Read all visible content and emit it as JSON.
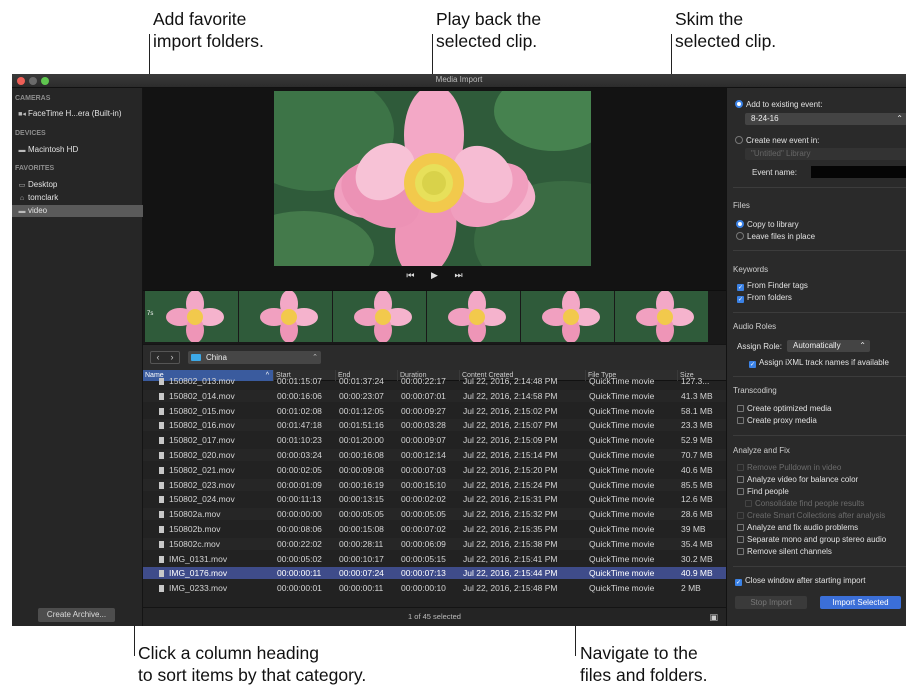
{
  "callouts": {
    "add_favorites": [
      "Add favorite",
      "import folders."
    ],
    "play_back": [
      "Play back the",
      "selected clip."
    ],
    "skim": [
      "Skim the",
      "selected clip."
    ],
    "sort": [
      "Click a column heading",
      "to sort items by that category."
    ],
    "navigate": [
      "Navigate to the",
      "files and folders."
    ]
  },
  "window": {
    "title": "Media Import"
  },
  "sidebar": {
    "cameras_header": "CAMERAS",
    "camera": "FaceTime H...era (Built-in)",
    "devices_header": "DEVICES",
    "device": "Macintosh HD",
    "favorites_header": "FAVORITES",
    "favorites": [
      "Desktop",
      "tomclark",
      "video"
    ],
    "selected_favorite": "video",
    "archive_button": "Create Archive..."
  },
  "transport": {
    "prev": "⏮",
    "play": "▶",
    "next": "⏭"
  },
  "filmstrip": {
    "badge": "7s"
  },
  "nav": {
    "back": "‹",
    "forward": "›",
    "folder": "China"
  },
  "table": {
    "columns": [
      "Name",
      "Start",
      "End",
      "Duration",
      "Content Created",
      "File Type",
      "Size"
    ],
    "sorted_column": "Name",
    "rows": [
      [
        "150802_013.mov",
        "00:01:15:07",
        "00:01:37:24",
        "00:00:22:17",
        "Jul 22, 2016, 2:14:48 PM",
        "QuickTime movie",
        "127.3..."
      ],
      [
        "150802_014.mov",
        "00:00:16:06",
        "00:00:23:07",
        "00:00:07:01",
        "Jul 22, 2016, 2:14:58 PM",
        "QuickTime movie",
        "41.3 MB"
      ],
      [
        "150802_015.mov",
        "00:01:02:08",
        "00:01:12:05",
        "00:00:09:27",
        "Jul 22, 2016, 2:15:02 PM",
        "QuickTime movie",
        "58.1 MB"
      ],
      [
        "150802_016.mov",
        "00:01:47:18",
        "00:01:51:16",
        "00:00:03:28",
        "Jul 22, 2016, 2:15:07 PM",
        "QuickTime movie",
        "23.3 MB"
      ],
      [
        "150802_017.mov",
        "00:01:10:23",
        "00:01:20:00",
        "00:00:09:07",
        "Jul 22, 2016, 2:15:09 PM",
        "QuickTime movie",
        "52.9 MB"
      ],
      [
        "150802_020.mov",
        "00:00:03:24",
        "00:00:16:08",
        "00:00:12:14",
        "Jul 22, 2016, 2:15:14 PM",
        "QuickTime movie",
        "70.7 MB"
      ],
      [
        "150802_021.mov",
        "00:00:02:05",
        "00:00:09:08",
        "00:00:07:03",
        "Jul 22, 2016, 2:15:20 PM",
        "QuickTime movie",
        "40.6 MB"
      ],
      [
        "150802_023.mov",
        "00:00:01:09",
        "00:00:16:19",
        "00:00:15:10",
        "Jul 22, 2016, 2:15:24 PM",
        "QuickTime movie",
        "85.5 MB"
      ],
      [
        "150802_024.mov",
        "00:00:11:13",
        "00:00:13:15",
        "00:00:02:02",
        "Jul 22, 2016, 2:15:31 PM",
        "QuickTime movie",
        "12.6 MB"
      ],
      [
        "150802a.mov",
        "00:00:00:00",
        "00:00:05:05",
        "00:00:05:05",
        "Jul 22, 2016, 2:15:32 PM",
        "QuickTime movie",
        "28.6 MB"
      ],
      [
        "150802b.mov",
        "00:00:08:06",
        "00:00:15:08",
        "00:00:07:02",
        "Jul 22, 2016, 2:15:35 PM",
        "QuickTime movie",
        "39 MB"
      ],
      [
        "150802c.mov",
        "00:00:22:02",
        "00:00:28:11",
        "00:00:06:09",
        "Jul 22, 2016, 2:15:38 PM",
        "QuickTime movie",
        "35.4 MB"
      ],
      [
        "IMG_0131.mov",
        "00:00:05:02",
        "00:00:10:17",
        "00:00:05:15",
        "Jul 22, 2016, 2:15:41 PM",
        "QuickTime movie",
        "30.2 MB"
      ],
      [
        "IMG_0176.mov",
        "00:00:00:11",
        "00:00:07:24",
        "00:00:07:13",
        "Jul 22, 2016, 2:15:44 PM",
        "QuickTime movie",
        "40.9 MB"
      ],
      [
        "IMG_0233.mov",
        "00:00:00:01",
        "00:00:00:11",
        "00:00:00:10",
        "Jul 22, 2016, 2:15:48 PM",
        "QuickTime movie",
        "2 MB"
      ]
    ],
    "selected_row": "IMG_0176.mov",
    "footer": "1 of 45 selected"
  },
  "right_panel": {
    "add_existing": "Add to existing event:",
    "event_value": "8-24-16",
    "create_new": "Create new event in:",
    "library_value": "\"Untitled\" Library",
    "event_name_label": "Event name:",
    "files_header": "Files",
    "copy_to_library": "Copy to library",
    "leave_in_place": "Leave files in place",
    "keywords_header": "Keywords",
    "from_finder_tags": "From Finder tags",
    "from_folders": "From folders",
    "audio_roles_header": "Audio Roles",
    "assign_role_label": "Assign Role:",
    "assign_role_value": "Automatically",
    "assign_ixml": "Assign iXML track names if available",
    "transcoding_header": "Transcoding",
    "create_optimized": "Create optimized media",
    "create_proxy": "Create proxy media",
    "analyze_header": "Analyze and Fix",
    "remove_pulldown": "Remove Pulldown in video",
    "analyze_color": "Analyze video for balance color",
    "find_people": "Find people",
    "consolidate_people": "Consolidate find people results",
    "smart_collections": "Create Smart Collections after analysis",
    "analyze_audio": "Analyze and fix audio problems",
    "separate_mono": "Separate mono and group stereo audio",
    "remove_silent": "Remove silent channels",
    "close_window": "Close window after starting import",
    "stop_import": "Stop Import",
    "import_selected": "Import Selected"
  },
  "colors": {
    "accent": "#3b82e6",
    "selection": "#3f4c8a",
    "sidebar_selection": "#5a5a5a"
  }
}
